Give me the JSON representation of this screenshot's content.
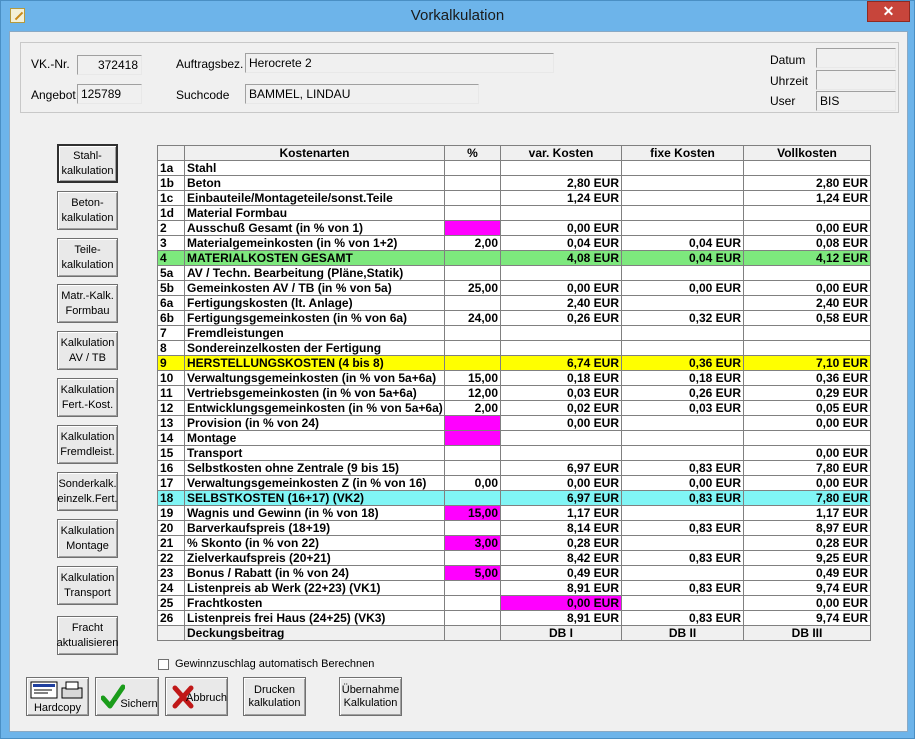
{
  "window": {
    "title": "Vorkalkulation",
    "close": "✕"
  },
  "header": {
    "vk_nr_label": "VK.-Nr.",
    "vk_nr": "372418",
    "angebot_label": "Angebot",
    "angebot": "125789",
    "auftragsbez_label": "Auftragsbez.",
    "auftragsbez": "Herocrete 2",
    "suchcode_label": "Suchcode",
    "suchcode": "BAMMEL, LINDAU",
    "datum_label": "Datum",
    "datum": "",
    "uhrzeit_label": "Uhrzeit",
    "uhrzeit": "",
    "user_label": "User",
    "user": "BIS"
  },
  "side_buttons": [
    "Stahl-\nkalkulation",
    "Beton-\nkalkulation",
    "Teile-\nkalkulation",
    "Matr.-Kalk.\nFormbau",
    "Kalkulation\nAV / TB",
    "Kalkulation\nFert.-Kost.",
    "Kalkulation\nFremdleist.",
    "Sonderkalk.\neinzelk.Fert.",
    "Kalkulation\nMontage",
    "Kalkulation\nTransport",
    "Fracht\naktualisieren"
  ],
  "table": {
    "headers": [
      "",
      "Kostenarten",
      "%",
      "var. Kosten",
      "fixe Kosten",
      "Vollkosten"
    ],
    "rows": [
      [
        "1a",
        "Stahl",
        "",
        "",
        "",
        ""
      ],
      [
        "1b",
        "Beton",
        "",
        "2,80 EUR",
        "",
        "2,80 EUR"
      ],
      [
        "1c",
        "Einbauteile/Montageteile/sonst.Teile",
        "",
        "1,24 EUR",
        "",
        "1,24 EUR"
      ],
      [
        "1d",
        "Material Formbau",
        "",
        "",
        "",
        ""
      ],
      [
        "2",
        "Ausschuß Gesamt (in % von 1)",
        "",
        "0,00 EUR",
        "",
        "0,00 EUR"
      ],
      [
        "3",
        "Materialgemeinkosten (in % von 1+2)",
        "2,00",
        "0,04 EUR",
        "0,04 EUR",
        "0,08 EUR"
      ],
      [
        "4",
        "MATERIALKOSTEN GESAMT",
        "",
        "4,08 EUR",
        "0,04 EUR",
        "4,12 EUR"
      ],
      [
        "5a",
        "AV / Techn. Bearbeitung (Pläne,Statik)",
        "",
        "",
        "",
        ""
      ],
      [
        "5b",
        "Gemeinkosten AV / TB (in % von 5a)",
        "25,00",
        "0,00 EUR",
        "0,00 EUR",
        "0,00 EUR"
      ],
      [
        "6a",
        "Fertigungskosten (lt. Anlage)",
        "",
        "2,40 EUR",
        "",
        "2,40 EUR"
      ],
      [
        "6b",
        "Fertigungsgemeinkosten (in % von 6a)",
        "24,00",
        "0,26 EUR",
        "0,32 EUR",
        "0,58 EUR"
      ],
      [
        "7",
        "Fremdleistungen",
        "",
        "",
        "",
        ""
      ],
      [
        "8",
        "Sondereinzelkosten der Fertigung",
        "",
        "",
        "",
        ""
      ],
      [
        "9",
        "HERSTELLUNGSKOSTEN (4 bis 8)",
        "",
        "6,74 EUR",
        "0,36 EUR",
        "7,10 EUR"
      ],
      [
        "10",
        "Verwaltungsgemeinkosten (in % von 5a+6a)",
        "15,00",
        "0,18 EUR",
        "0,18 EUR",
        "0,36 EUR"
      ],
      [
        "11",
        "Vertriebsgemeinkosten (in % von 5a+6a)",
        "12,00",
        "0,03 EUR",
        "0,26 EUR",
        "0,29 EUR"
      ],
      [
        "12",
        "Entwicklungsgemeinkosten (in % von 5a+6a)",
        "2,00",
        "0,02 EUR",
        "0,03 EUR",
        "0,05 EUR"
      ],
      [
        "13",
        "Provision (in % von 24)",
        "",
        "0,00 EUR",
        "",
        "0,00 EUR"
      ],
      [
        "14",
        "Montage",
        "",
        "",
        "",
        ""
      ],
      [
        "15",
        "Transport",
        "",
        "",
        "",
        "0,00 EUR"
      ],
      [
        "16",
        "Selbstkosten ohne Zentrale (9 bis 15)",
        "",
        "6,97 EUR",
        "0,83 EUR",
        "7,80 EUR"
      ],
      [
        "17",
        "Verwaltungsgemeinkosten Z (in % von 16)",
        "0,00",
        "0,00 EUR",
        "0,00 EUR",
        "0,00 EUR"
      ],
      [
        "18",
        "SELBSTKOSTEN (16+17) (VK2)",
        "",
        "6,97 EUR",
        "0,83 EUR",
        "7,80 EUR"
      ],
      [
        "19",
        "Wagnis und Gewinn (in % von 18)",
        "15,00",
        "1,17 EUR",
        "",
        "1,17 EUR"
      ],
      [
        "20",
        "Barverkaufspreis (18+19)",
        "",
        "8,14 EUR",
        "0,83 EUR",
        "8,97 EUR"
      ],
      [
        "21",
        "% Skonto (in % von 22)",
        "3,00",
        "0,28 EUR",
        "",
        "0,28 EUR"
      ],
      [
        "22",
        "Zielverkaufspreis (20+21)",
        "",
        "8,42 EUR",
        "0,83 EUR",
        "9,25 EUR"
      ],
      [
        "23",
        "Bonus / Rabatt (in % von 24)",
        "5,00",
        "0,49 EUR",
        "",
        "0,49 EUR"
      ],
      [
        "24",
        "Listenpreis ab Werk (22+23) (VK1)",
        "",
        "8,91 EUR",
        "0,83 EUR",
        "9,74 EUR"
      ],
      [
        "25",
        "Frachtkosten",
        "",
        "0,00 EUR",
        "",
        "0,00 EUR"
      ],
      [
        "26",
        "Listenpreis frei Haus (24+25) (VK3)",
        "",
        "8,91 EUR",
        "0,83 EUR",
        "9,74 EUR"
      ]
    ],
    "footer": [
      "",
      "Deckungsbeitrag",
      "",
      "DB I",
      "DB II",
      "DB III"
    ],
    "row_highlight": {
      "6": "green",
      "13": "yellow",
      "22": "cyan"
    },
    "magenta_cells": [
      "4-2",
      "17-2",
      "18-2",
      "23-2",
      "25-2",
      "27-2",
      "29-3"
    ]
  },
  "checkbox": {
    "label": "Gewinnzuschlag automatisch Berechnen",
    "checked": false
  },
  "bottom_buttons": {
    "hardcopy": "Hardcopy",
    "sichern": "Sichern",
    "abbruch": "Abbruch",
    "drucken": "Drucken\nkalkulation",
    "uebernahme": "Übernahme\nKalkulation"
  },
  "colors": {
    "green": "#7de87d",
    "yellow": "#ffff00",
    "cyan": "#80f5f5",
    "magenta": "#ff00ff"
  }
}
